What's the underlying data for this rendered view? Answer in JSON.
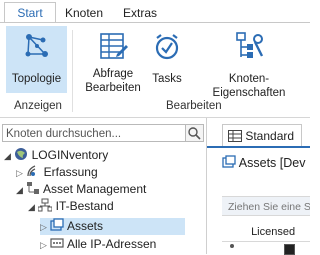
{
  "tabs": [
    {
      "label": "Start",
      "active": true
    },
    {
      "label": "Knoten",
      "active": false
    },
    {
      "label": "Extras",
      "active": false
    }
  ],
  "ribbon": {
    "groups": [
      {
        "label": "Anzeigen"
      },
      {
        "label": "Bearbeiten"
      }
    ],
    "buttons": [
      {
        "label": "Topologie",
        "icon": "topology-icon",
        "selected": true
      },
      {
        "label_line1": "Abfrage",
        "label_line2": "Bearbeiten",
        "icon": "query-table-icon"
      },
      {
        "label": "Tasks",
        "icon": "clock-icon"
      },
      {
        "label": "Knoten-Eigenschaften",
        "icon": "node-properties-icon"
      }
    ]
  },
  "search": {
    "placeholder": "Knoten durchsuchen..."
  },
  "tree": [
    {
      "label": "LOGINventory",
      "icon": "globe-icon"
    },
    {
      "label": "Erfassung",
      "icon": "antenna-icon"
    },
    {
      "label": "Asset Management",
      "icon": "hierarchy-icon"
    },
    {
      "label": "IT-Bestand",
      "icon": "network-icon"
    },
    {
      "label": "Assets",
      "icon": "assets-icon",
      "selected": true
    },
    {
      "label": "Alle IP-Adressen",
      "icon": "ip-icon"
    }
  ],
  "document": {
    "tab_label": "Standard",
    "title": "Assets [Dev",
    "group_hint": "Ziehen Sie eine Sp",
    "column": "Licensed"
  },
  "colors": {
    "accent": "#2b6cb4",
    "selection": "#cde4f7"
  }
}
